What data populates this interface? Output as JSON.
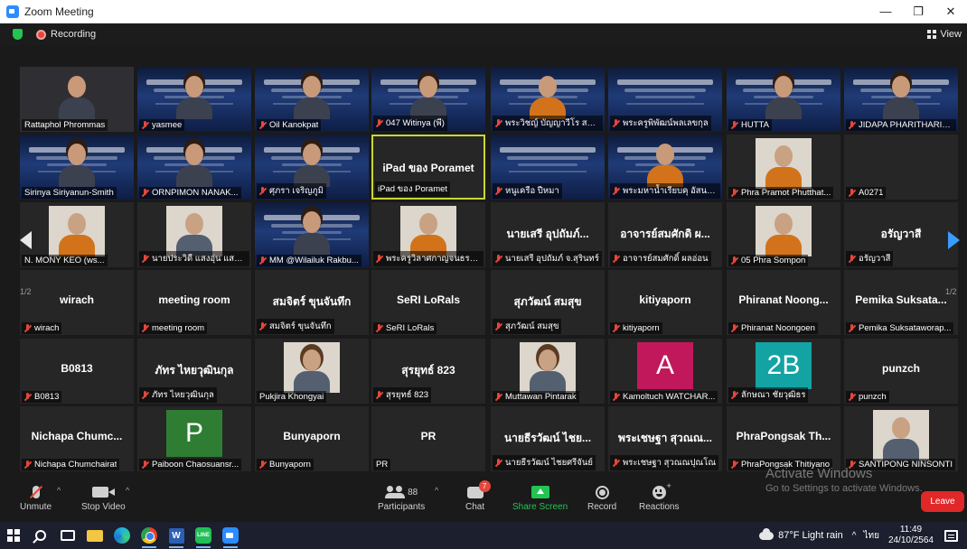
{
  "window": {
    "title": "Zoom Meeting",
    "minimize": "—",
    "restore": "❐",
    "close": "✕"
  },
  "meeting": {
    "recording_label": "Recording",
    "view_label": "View"
  },
  "gallery": {
    "page_left": "1/2",
    "page_right": "1/2",
    "tiles": [
      {
        "label": "Rattaphol Phrommas",
        "kind": "cam",
        "muted": false
      },
      {
        "label": "yasmee",
        "kind": "slidecam",
        "muted": true
      },
      {
        "label": "Oil Kanokpat",
        "kind": "slidecam",
        "muted": true
      },
      {
        "label": "047 Witinya (พี)",
        "kind": "slidecam",
        "muted": true
      },
      {
        "label": "พระวิชญ์ บัญญาวีโร สาย...",
        "kind": "slidemonk",
        "muted": true
      },
      {
        "label": "พระครูพิพัฒน์พลเลขกุล",
        "kind": "slide",
        "muted": true
      },
      {
        "label": "HUTTA",
        "kind": "slidecam",
        "muted": true
      },
      {
        "label": "JIDAPA PHARITHARICH",
        "kind": "slidecam",
        "muted": true
      },
      {
        "label": "Sirinya Siriyanun-Smith",
        "kind": "slidecam",
        "muted": false
      },
      {
        "label": "ORNPIMON NANAK...",
        "kind": "slidecam",
        "muted": true
      },
      {
        "label": "ศุภรา เจริญภูมิ",
        "kind": "slidecam",
        "muted": true
      },
      {
        "label": "iPad ของ Poramet",
        "kind": "name",
        "big": "iPad ของ Poramet",
        "muted": false,
        "active": true
      },
      {
        "label": "หนูเครือ ปีหมา",
        "kind": "slide",
        "muted": true
      },
      {
        "label": "พระมหาน้ำเรียบคุ อัสนพัช",
        "kind": "slidemonk",
        "muted": true
      },
      {
        "label": "Phra Pramot Phutthat...",
        "kind": "photomonk",
        "muted": true
      },
      {
        "label": "A0271",
        "kind": "blank",
        "muted": true
      },
      {
        "label": "N. MONY KEO (ws...",
        "kind": "photomonk",
        "muted": false
      },
      {
        "label": "นายประวิดี แสงอุ่น แสงอุ่น",
        "kind": "photo",
        "muted": true
      },
      {
        "label": "MM @Wilailuk Rakbu...",
        "kind": "slidecam",
        "muted": true
      },
      {
        "label": "พระครูวิลาศกาญจนธรรม...",
        "kind": "photomonk",
        "muted": true
      },
      {
        "label": "นายเสรี อุปถัมภ์ จ.สุรินทร์",
        "kind": "name",
        "big": "นายเสรี อุปถัมภ์...",
        "muted": true
      },
      {
        "label": "อาจารย์สมศักดิ์ ผลอ่อน",
        "kind": "name",
        "big": "อาจารย์สมศักดิ ผ...",
        "muted": true
      },
      {
        "label": "05 Phra Sompon",
        "kind": "photomonk",
        "muted": true
      },
      {
        "label": "อรัญวาสี",
        "kind": "name",
        "big": "อรัญวาสี",
        "muted": true
      },
      {
        "label": "wirach",
        "kind": "name",
        "big": "wirach",
        "muted": true
      },
      {
        "label": "meeting room",
        "kind": "name",
        "big": "meeting room",
        "muted": true
      },
      {
        "label": "สมจิตร์ ขุนจันทึก",
        "kind": "name",
        "big": "สมจิตร์ ขุนจันทึก",
        "muted": true
      },
      {
        "label": "SeRI LoRals",
        "kind": "name",
        "big": "SeRI LoRals",
        "muted": true
      },
      {
        "label": "สุภวัฒน์ สมสุข",
        "kind": "name",
        "big": "สุภวัฒน์ สมสุข",
        "muted": true
      },
      {
        "label": "kitiyaporn",
        "kind": "name",
        "big": "kitiyaporn",
        "muted": true
      },
      {
        "label": "Phiranat Noongoen",
        "kind": "name",
        "big": "Phiranat Noong...",
        "muted": true
      },
      {
        "label": "Pemika Suksataworap...",
        "kind": "name",
        "big": "Pemika Suksata...",
        "muted": true
      },
      {
        "label": "B0813",
        "kind": "name",
        "big": "B0813",
        "muted": true
      },
      {
        "label": "ภัทร ไหยวุฒินกุล",
        "kind": "name",
        "big": "ภัทร ไหยวุฒินกุล",
        "muted": true
      },
      {
        "label": "Pukjira Khongyai",
        "kind": "photohair",
        "muted": false
      },
      {
        "label": "สุรยุทธ์ 823",
        "kind": "name",
        "big": "สุรยุทธ์ 823",
        "muted": true
      },
      {
        "label": "Muttawan Pintarak",
        "kind": "photohair",
        "muted": true
      },
      {
        "label": "Kamoltuch WATCHAR...",
        "kind": "avatar",
        "avatar": "A",
        "avatar_color": "#c1185b",
        "muted": true
      },
      {
        "label": "ลักษณา ชัยวุฒิธร",
        "kind": "avatar",
        "avatar": "2B",
        "avatar_color": "#13a3a3",
        "muted": true
      },
      {
        "label": "punzch",
        "kind": "name",
        "big": "punzch",
        "muted": true
      },
      {
        "label": "Nichapa Chumchairat",
        "kind": "name",
        "big": "Nichapa Chumc...",
        "muted": true
      },
      {
        "label": "Paiboon Chaosuansr...",
        "kind": "avatar",
        "avatar": "P",
        "avatar_color": "#2e7d32",
        "muted": true
      },
      {
        "label": "Bunyaporn",
        "kind": "name",
        "big": "Bunyaporn",
        "muted": true
      },
      {
        "label": "PR",
        "kind": "name",
        "big": "PR",
        "muted": false
      },
      {
        "label": "นายธีรวัฒน์ ไชยศรีจันย์",
        "kind": "name",
        "big": "นายธีรวัฒน์ ไชย...",
        "muted": true
      },
      {
        "label": "พระเชษฐา สุวณณปุณโณ",
        "kind": "name",
        "big": "พระเชษฐา สุวณณ...",
        "muted": true
      },
      {
        "label": "PhraPongsak Thitiyano",
        "kind": "name",
        "big": "PhraPongsak Th...",
        "muted": true
      },
      {
        "label": "SANTIPONG NINSONTI",
        "kind": "photo",
        "muted": true
      }
    ]
  },
  "toolbar": {
    "unmute": "Unmute",
    "stop_video": "Stop Video",
    "participants": "Participants",
    "participants_count": "88",
    "chat": "Chat",
    "chat_badge": "7",
    "share": "Share Screen",
    "record": "Record",
    "reactions": "Reactions",
    "leave": "Leave"
  },
  "watermark": {
    "line1": "Activate Windows",
    "line2": "Go to Settings to activate Windows."
  },
  "taskbar": {
    "word_label": "W",
    "line_label": "LINE",
    "weather": "87°F  Light rain",
    "chevron": "^",
    "lang": "ไทย",
    "time": "11:49",
    "date": "24/10/2564"
  },
  "colors": {
    "active_speaker": "#c6d833",
    "share_green": "#23c552",
    "leave_red": "#e02828",
    "muted_red": "#e5473b"
  }
}
